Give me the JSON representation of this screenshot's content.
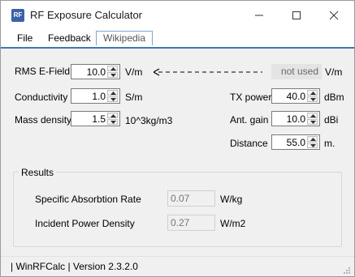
{
  "window": {
    "title": "RF Exposure Calculator",
    "icon_text": "RF",
    "icon_color": "#3b62a8"
  },
  "menu": {
    "items": [
      "File",
      "Feedback",
      "Wikipedia"
    ]
  },
  "inputs": {
    "rms_efield": {
      "label": "RMS E-Field",
      "value": "10.0",
      "unit": "V/m"
    },
    "conductivity": {
      "label": "Conductivity",
      "value": "1.0",
      "unit": "S/m"
    },
    "mass_density": {
      "label": "Mass density",
      "value": "1.5",
      "unit": "10^3kg/m3"
    },
    "not_used": {
      "value": "not used",
      "unit": "V/m"
    },
    "tx_power": {
      "label": "TX power",
      "value": "40.0",
      "unit": "dBm"
    },
    "ant_gain": {
      "label": "Ant. gain",
      "value": "10.0",
      "unit": "dBi"
    },
    "distance": {
      "label": "Distance",
      "value": "55.0",
      "unit": "m."
    }
  },
  "results": {
    "title": "Results",
    "sar": {
      "label": "Specific Absorbtion Rate",
      "value": "0.07",
      "unit": "W/kg"
    },
    "ipd": {
      "label": "Incident Power Density",
      "value": "0.27",
      "unit": "W/m2"
    }
  },
  "status": {
    "text": "| WinRFCalc | Version 2.3.2.0"
  }
}
